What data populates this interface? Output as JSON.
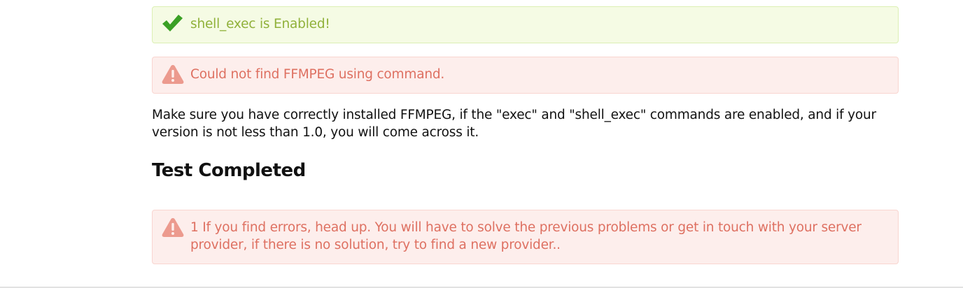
{
  "colors": {
    "success_bg": "#f5fbe4",
    "success_text": "#90b13a",
    "success_icon": "#3aa025",
    "danger_bg": "#fdeeec",
    "danger_text": "#de7061",
    "danger_icon": "#ec9a8e"
  },
  "alerts": {
    "shell_exec": {
      "icon": "checkmark-icon",
      "text": "shell_exec is Enabled!"
    },
    "ffmpeg": {
      "icon": "warning-triangle-icon",
      "text": "Could not find FFMPEG using command."
    },
    "final": {
      "icon": "warning-triangle-icon",
      "text": "1 If you find errors, head up. You will have to solve the previous problems or get in touch with your server provider, if there is no solution, try to find a new provider.."
    }
  },
  "info_text": "Make sure you have correctly installed FFMPEG, if the \"exec\" and \"shell_exec\" commands are enabled, and if your version is not less than 1.0, you will come across it.",
  "heading": "Test Completed"
}
